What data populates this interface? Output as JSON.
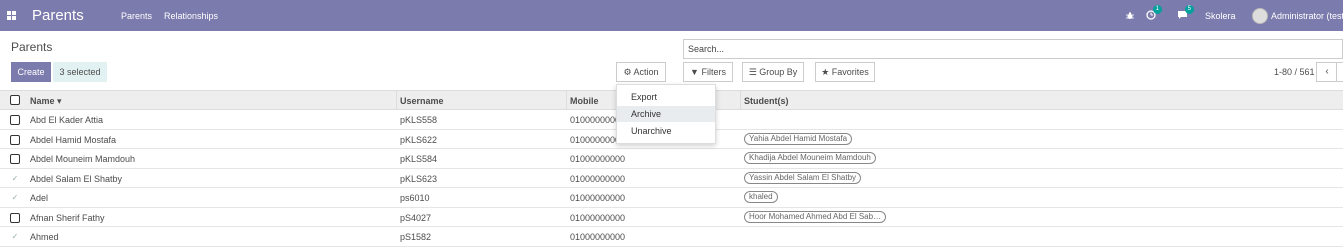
{
  "navbar": {
    "app_title": "Parents",
    "menu": [
      "Parents",
      "Relationships"
    ],
    "activity_badge": "1",
    "messages_badge": "5",
    "company": "Skolera",
    "user": "Administrator (testi"
  },
  "breadcrumb": "Parents",
  "buttons": {
    "create": "Create",
    "selected": "3 selected",
    "action": "Action"
  },
  "search": {
    "placeholder": "Search..."
  },
  "filters": {
    "filters": "Filters",
    "group_by": "Group By",
    "favorites": "Favorites"
  },
  "pager": {
    "value": "1-80 / 561",
    "prev": "‹"
  },
  "action_menu": [
    "Export",
    "Archive",
    "Unarchive"
  ],
  "table": {
    "columns": [
      "Name",
      "Username",
      "Mobile",
      "Student(s)"
    ],
    "rows": [
      {
        "checked": false,
        "name": "Abd El Kader Attia",
        "username": "pKLS558",
        "mobile": "01000000000",
        "students": ""
      },
      {
        "checked": false,
        "name": "Abdel Hamid Mostafa",
        "username": "pKLS622",
        "mobile": "01000000000",
        "students": "Yahia Abdel Hamid Mostafa"
      },
      {
        "checked": false,
        "name": "Abdel Mouneim Mamdouh",
        "username": "pKLS584",
        "mobile": "01000000000",
        "students": "Khadija Abdel Mouneim Mamdouh"
      },
      {
        "checked": true,
        "name": "Abdel Salam El Shatby",
        "username": "pKLS623",
        "mobile": "01000000000",
        "students": "Yassin Abdel Salam El Shatby"
      },
      {
        "checked": true,
        "name": "Adel",
        "username": "ps6010",
        "mobile": "01000000000",
        "students": "khaled"
      },
      {
        "checked": false,
        "name": "Afnan Sherif Fathy",
        "username": "pS4027",
        "mobile": "01000000000",
        "students": "Hoor Mohamed Ahmed Abd El Sab…"
      },
      {
        "checked": true,
        "name": "Ahmed",
        "username": "pS1582",
        "mobile": "01000000000",
        "students": ""
      }
    ]
  },
  "colors": {
    "brand": "#7c7bad",
    "badge": "#00a09d",
    "selected_bg": "#e2f2f2"
  }
}
